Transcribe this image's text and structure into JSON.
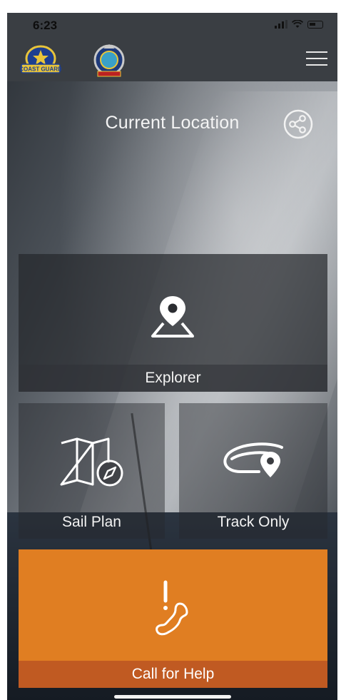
{
  "status_bar": {
    "time": "6:23"
  },
  "header": {
    "logo_left": "Australian Volunteer Coast Guard",
    "logo_left_text": "COAST GUARD",
    "menu_icon": "hamburger-menu-icon"
  },
  "location": {
    "title": "Current Location",
    "share_icon": "share-icon"
  },
  "tiles": {
    "explorer": {
      "label": "Explorer",
      "icon": "map-pin-icon"
    },
    "sail_plan": {
      "label": "Sail Plan",
      "icon": "map-compass-icon"
    },
    "track_only": {
      "label": "Track Only",
      "icon": "track-route-icon"
    }
  },
  "help": {
    "label": "Call for Help",
    "icon": "phone-alert-icon"
  },
  "colors": {
    "accent": "#e07e22",
    "accent_dark": "#c05a22",
    "header": "#3a3e43"
  }
}
